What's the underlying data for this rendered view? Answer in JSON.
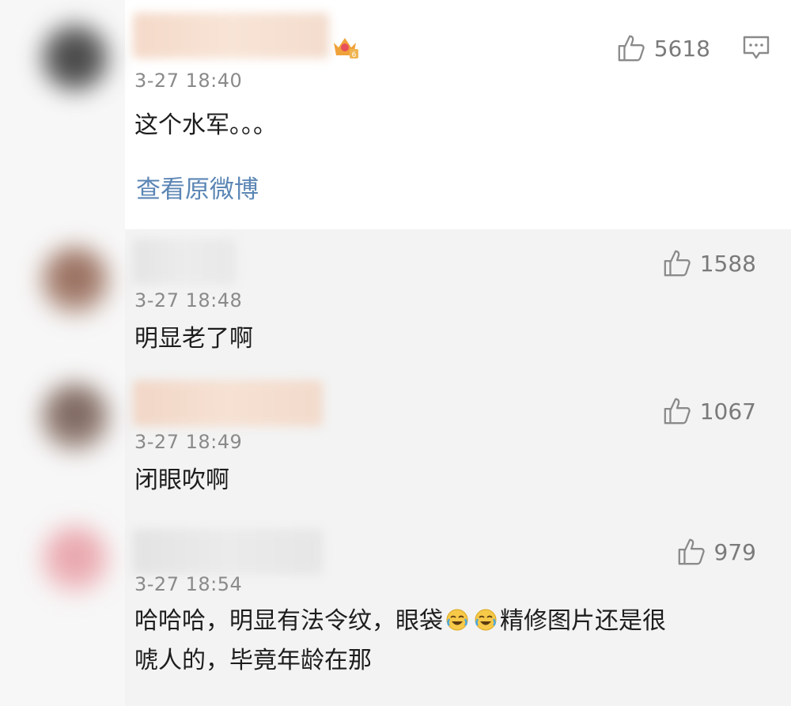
{
  "comments": [
    {
      "time": "3-27 18:40",
      "text": "这个水军。。。",
      "likes": "5618",
      "link": "查看原微博"
    },
    {
      "time": "3-27 18:48",
      "text": "明显老了啊",
      "likes": "1588"
    },
    {
      "time": "3-27 18:49",
      "text": "闭眼吹啊",
      "likes": "1067"
    },
    {
      "time": "3-27 18:54",
      "text_part1": "哈哈哈，明显有法令纹，眼袋",
      "text_part2": "精修图片还是很",
      "text_line2": "唬人的，毕竟年龄在那",
      "likes": "979"
    }
  ],
  "colors": {
    "link": "#5b86b5",
    "time": "#8a8a8a",
    "like": "#7a7a7a"
  },
  "icons": {
    "like": "thumbs-up-icon",
    "reply": "comment-icon",
    "badge": "crown-badge-icon",
    "emoji": "laugh-cry-emoji"
  }
}
